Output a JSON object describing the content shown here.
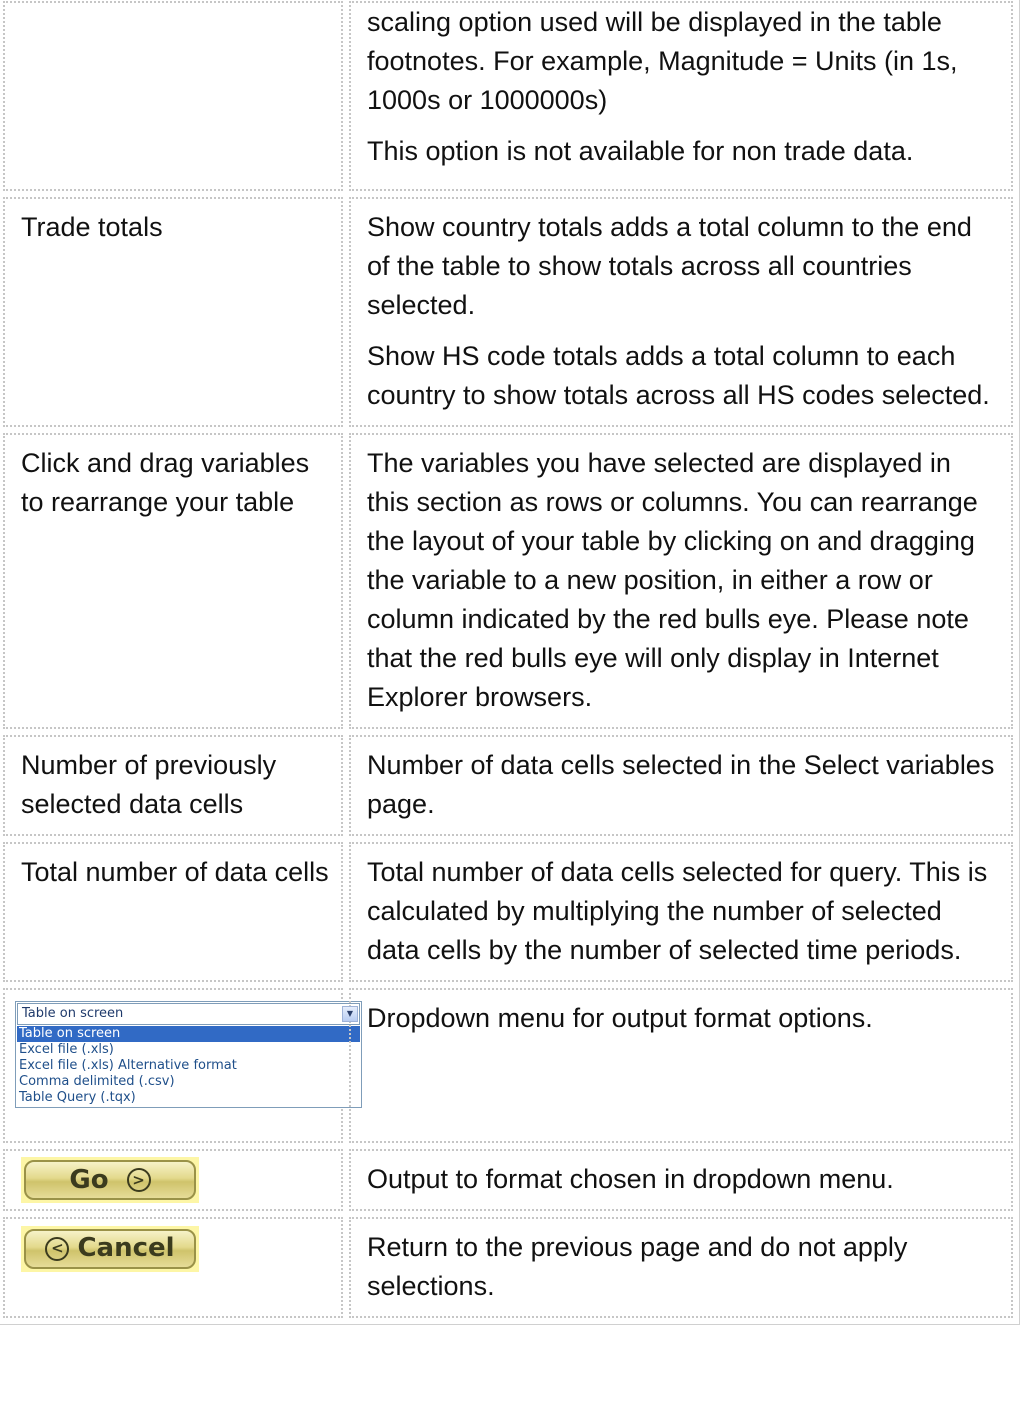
{
  "rows": [
    {
      "label": "",
      "paragraphs": [
        "scaling option used will be displayed in the table footnotes. For example, Magnitude = Units (in 1s, 1000s or 1000000s)",
        "This option is not available for non trade data."
      ]
    },
    {
      "label": "Trade totals",
      "paragraphs": [
        "Show country totals adds a total column to the end of the table to show totals across all countries selected.",
        "Show HS code totals adds a total column to each country to show totals across all HS codes selected."
      ]
    },
    {
      "label": "Click and drag variables to rearrange your table",
      "paragraphs": [
        "The variables you have selected are displayed in this section as rows or columns. You can rearrange the layout of your table by clicking on and dragging the variable to a new position, in either a row or column indicated by the red bulls eye. Please note that the red bulls eye will only display in Internet Explorer browsers."
      ]
    },
    {
      "label": "Number of previously selected data cells",
      "paragraphs": [
        "Number of data cells selected in the Select variables page."
      ]
    },
    {
      "label": "Total number of data cells",
      "paragraphs": [
        "Total number of data cells selected for query. This is calculated by multiplying the number of selected data cells by the number of selected time periods."
      ]
    },
    {
      "dropdown": {
        "selected_value": "Table on screen",
        "options": [
          "Table on screen",
          "Excel file (.xls)",
          "Excel file (.xls) Alternative format",
          "Comma delimited (.csv)",
          "Table Query (.tqx)"
        ],
        "highlighted_option": "Table on screen"
      },
      "paragraphs": [
        "Dropdown menu for output format options."
      ]
    },
    {
      "button": {
        "label": "Go",
        "icon": "arrow-right-circle-icon"
      },
      "paragraphs": [
        "Output to format chosen in dropdown menu."
      ]
    },
    {
      "button": {
        "label": "Cancel",
        "icon": "arrow-left-circle-icon"
      },
      "paragraphs": [
        "Return to the previous page and do not apply selections."
      ]
    }
  ],
  "colors": {
    "button_highlight": "#fdf6a6",
    "select_highlight": "#316ac5",
    "cell_border": "#c6c6c6"
  }
}
